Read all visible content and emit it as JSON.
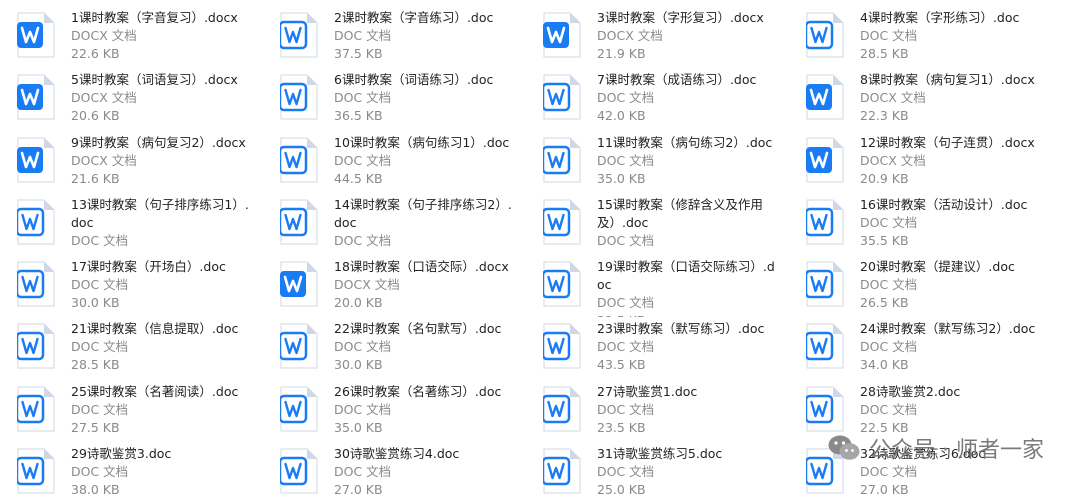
{
  "files": [
    {
      "name": "1课时教案（字音复习）.docx",
      "type": "DOCX 文档",
      "size": "22.6 KB",
      "icon": "wps-writer-blue-icon",
      "filled": true
    },
    {
      "name": "2课时教案（字音练习）.doc",
      "type": "DOC 文档",
      "size": "37.5 KB",
      "icon": "word-doc-icon",
      "filled": false
    },
    {
      "name": "3课时教案（字形复习）.docx",
      "type": "DOCX 文档",
      "size": "21.9 KB",
      "icon": "wps-writer-blue-icon",
      "filled": true
    },
    {
      "name": "4课时教案（字形练习）.doc",
      "type": "DOC 文档",
      "size": "28.5 KB",
      "icon": "word-doc-icon",
      "filled": false
    },
    {
      "name": "5课时教案（词语复习）.docx",
      "type": "DOCX 文档",
      "size": "20.6 KB",
      "icon": "wps-writer-blue-icon",
      "filled": true
    },
    {
      "name": "6课时教案（词语练习）.doc",
      "type": "DOC 文档",
      "size": "36.5 KB",
      "icon": "word-doc-icon",
      "filled": false
    },
    {
      "name": "7课时教案（成语练习）.doc",
      "type": "DOC 文档",
      "size": "42.0 KB",
      "icon": "word-doc-icon",
      "filled": false
    },
    {
      "name": "8课时教案（病句复习1）.docx",
      "type": "DOCX 文档",
      "size": "22.3 KB",
      "icon": "wps-writer-blue-icon",
      "filled": true
    },
    {
      "name": "9课时教案（病句复习2）.docx",
      "type": "DOCX 文档",
      "size": "21.6 KB",
      "icon": "wps-writer-blue-icon",
      "filled": true
    },
    {
      "name": "10课时教案（病句练习1）.doc",
      "type": "DOC 文档",
      "size": "44.5 KB",
      "icon": "word-doc-icon",
      "filled": false
    },
    {
      "name": "11课时教案（病句练习2）.doc",
      "type": "DOC 文档",
      "size": "35.0 KB",
      "icon": "word-doc-icon",
      "filled": false
    },
    {
      "name": "12课时教案（句子连贯）.docx",
      "type": "DOCX 文档",
      "size": "20.9 KB",
      "icon": "wps-writer-blue-icon",
      "filled": true
    },
    {
      "name": "13课时教案（句子排序练习1）.doc",
      "type": "DOC 文档",
      "size": "",
      "icon": "word-doc-icon",
      "filled": false
    },
    {
      "name": "14课时教案（句子排序练习2）.doc",
      "type": "DOC 文档",
      "size": "",
      "icon": "word-doc-icon",
      "filled": false
    },
    {
      "name": "15课时教案（修辞含义及作用及）.doc",
      "type": "DOC 文档",
      "size": "",
      "icon": "word-doc-icon",
      "filled": false
    },
    {
      "name": "16课时教案（活动设计）.doc",
      "type": "DOC 文档",
      "size": "35.5 KB",
      "icon": "word-doc-icon",
      "filled": false
    },
    {
      "name": "17课时教案（开场白）.doc",
      "type": "DOC 文档",
      "size": "30.0 KB",
      "icon": "word-doc-icon",
      "filled": false
    },
    {
      "name": "18课时教案（口语交际）.docx",
      "type": "DOCX 文档",
      "size": "20.0 KB",
      "icon": "wps-writer-blue-icon",
      "filled": true
    },
    {
      "name": "19课时教案（口语交际练习）.doc",
      "type": "DOC 文档",
      "size": "32.5 KB",
      "icon": "word-doc-icon",
      "filled": false
    },
    {
      "name": "20课时教案（提建议）.doc",
      "type": "DOC 文档",
      "size": "26.5 KB",
      "icon": "word-doc-icon",
      "filled": false
    },
    {
      "name": "21课时教案（信息提取）.doc",
      "type": "DOC 文档",
      "size": "28.5 KB",
      "icon": "word-doc-icon",
      "filled": false
    },
    {
      "name": "22课时教案（名句默写）.doc",
      "type": "DOC 文档",
      "size": "30.0 KB",
      "icon": "word-doc-icon",
      "filled": false
    },
    {
      "name": "23课时教案（默写练习）.doc",
      "type": "DOC 文档",
      "size": "43.5 KB",
      "icon": "word-doc-icon",
      "filled": false
    },
    {
      "name": "24课时教案（默写练习2）.doc",
      "type": "DOC 文档",
      "size": "34.0 KB",
      "icon": "word-doc-icon",
      "filled": false
    },
    {
      "name": "25课时教案（名著阅读）.doc",
      "type": "DOC 文档",
      "size": "27.5 KB",
      "icon": "word-doc-icon",
      "filled": false
    },
    {
      "name": "26课时教案（名著练习）.doc",
      "type": "DOC 文档",
      "size": "35.0 KB",
      "icon": "word-doc-icon",
      "filled": false
    },
    {
      "name": "27诗歌鉴赏1.doc",
      "type": "DOC 文档",
      "size": "23.5 KB",
      "icon": "word-doc-icon",
      "filled": false
    },
    {
      "name": "28诗歌鉴赏2.doc",
      "type": "DOC 文档",
      "size": "22.5 KB",
      "icon": "word-doc-icon",
      "filled": false
    },
    {
      "name": "29诗歌鉴赏3.doc",
      "type": "DOC 文档",
      "size": "38.0 KB",
      "icon": "word-doc-icon",
      "filled": false
    },
    {
      "name": "30诗歌鉴赏练习4.doc",
      "type": "DOC 文档",
      "size": "27.0 KB",
      "icon": "word-doc-icon",
      "filled": false
    },
    {
      "name": "31诗歌鉴赏练习5.doc",
      "type": "DOC 文档",
      "size": "25.0 KB",
      "icon": "word-doc-icon",
      "filled": false
    },
    {
      "name": "32诗歌鉴赏练习6.doc",
      "type": "DOC 文档",
      "size": "27.0 KB",
      "icon": "word-doc-icon",
      "filled": false
    }
  ],
  "watermark": {
    "text": "公众号 · 师者一家",
    "icon": "wechat-icon"
  },
  "colors": {
    "accent": "#1a7cf5",
    "text": "#222222",
    "muted": "#8a8a8a",
    "page": "#cfd8e6"
  }
}
